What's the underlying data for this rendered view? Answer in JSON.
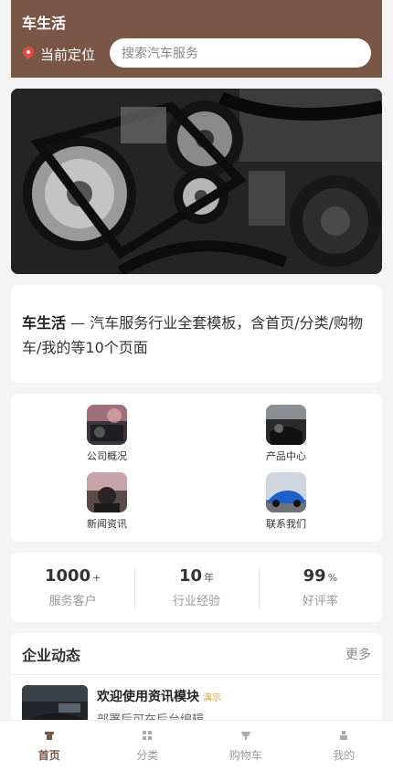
{
  "header": {
    "app_title": "车生活",
    "location_label": "当前定位",
    "search_placeholder": "搜索汽车服务"
  },
  "intro": {
    "brand": "车生活",
    "text": " — 汽车服务行业全套模板，含首页/分类/购物车/我的等10个页面"
  },
  "quick_links": [
    {
      "label": "公司概况",
      "icon": "company-photo"
    },
    {
      "label": "产品中心",
      "icon": "car-interior-photo"
    },
    {
      "label": "新闻资讯",
      "icon": "news-photo"
    },
    {
      "label": "联系我们",
      "icon": "blue-car-photo"
    }
  ],
  "stats": [
    {
      "value": "1000",
      "unit": "+",
      "label": "服务客户"
    },
    {
      "value": "10",
      "unit": "年",
      "label": "行业经验"
    },
    {
      "value": "99",
      "unit": "%",
      "label": "好评率"
    }
  ],
  "news": {
    "title": "企业动态",
    "more": "更多",
    "items": [
      {
        "title": "欢迎使用资讯模块",
        "badge": "演示",
        "desc": "部署后可在后台编辑"
      }
    ]
  },
  "tabbar": [
    {
      "label": "首页",
      "active": true
    },
    {
      "label": "分类",
      "active": false
    },
    {
      "label": "购物车",
      "active": false
    },
    {
      "label": "我的",
      "active": false
    }
  ],
  "colors": {
    "brand": "#7a5647",
    "badge": "#e6a23c"
  }
}
